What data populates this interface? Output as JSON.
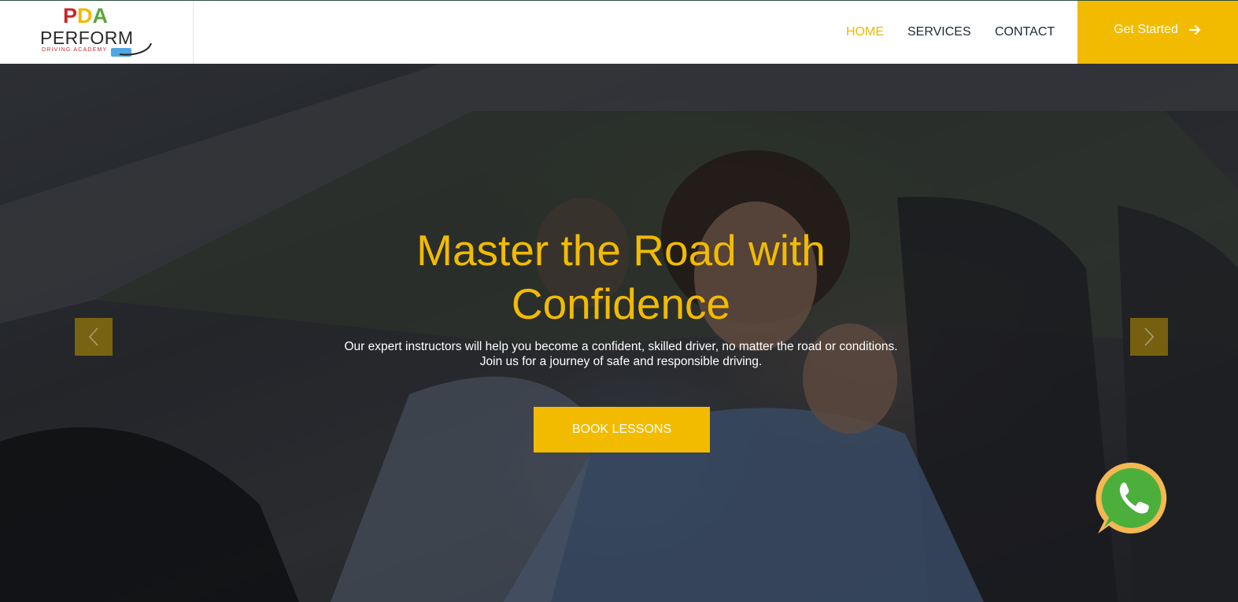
{
  "header": {
    "logo": {
      "letters": [
        "P",
        "D",
        "A"
      ],
      "letter_colors": [
        "#c8282c",
        "#f2bb00",
        "#5aa63a"
      ],
      "word": "PERFORM",
      "sub": "DRIVING ACADEMY"
    },
    "nav": [
      {
        "label": "HOME",
        "active": true
      },
      {
        "label": "SERVICES",
        "active": false
      },
      {
        "label": "CONTACT",
        "active": false
      }
    ],
    "cta": {
      "label": "Get Started",
      "icon": "arrow-right-icon"
    }
  },
  "hero": {
    "title": "Master the Road with Confidence",
    "subtitle_line1": "Our expert instructors will help you become a confident, skilled driver, no matter the road or conditions.",
    "subtitle_line2": "Join us for a journey of safe and responsible driving.",
    "button_label": "BOOK LESSONS",
    "prev_icon": "chevron-left-icon",
    "next_icon": "chevron-right-icon"
  },
  "whatsapp": {
    "icon": "whatsapp-icon"
  },
  "colors": {
    "accent": "#f2bb00",
    "nav_text": "#1e2a3a",
    "whatsapp_green": "#4caf3c",
    "whatsapp_ring": "#f4b752"
  }
}
